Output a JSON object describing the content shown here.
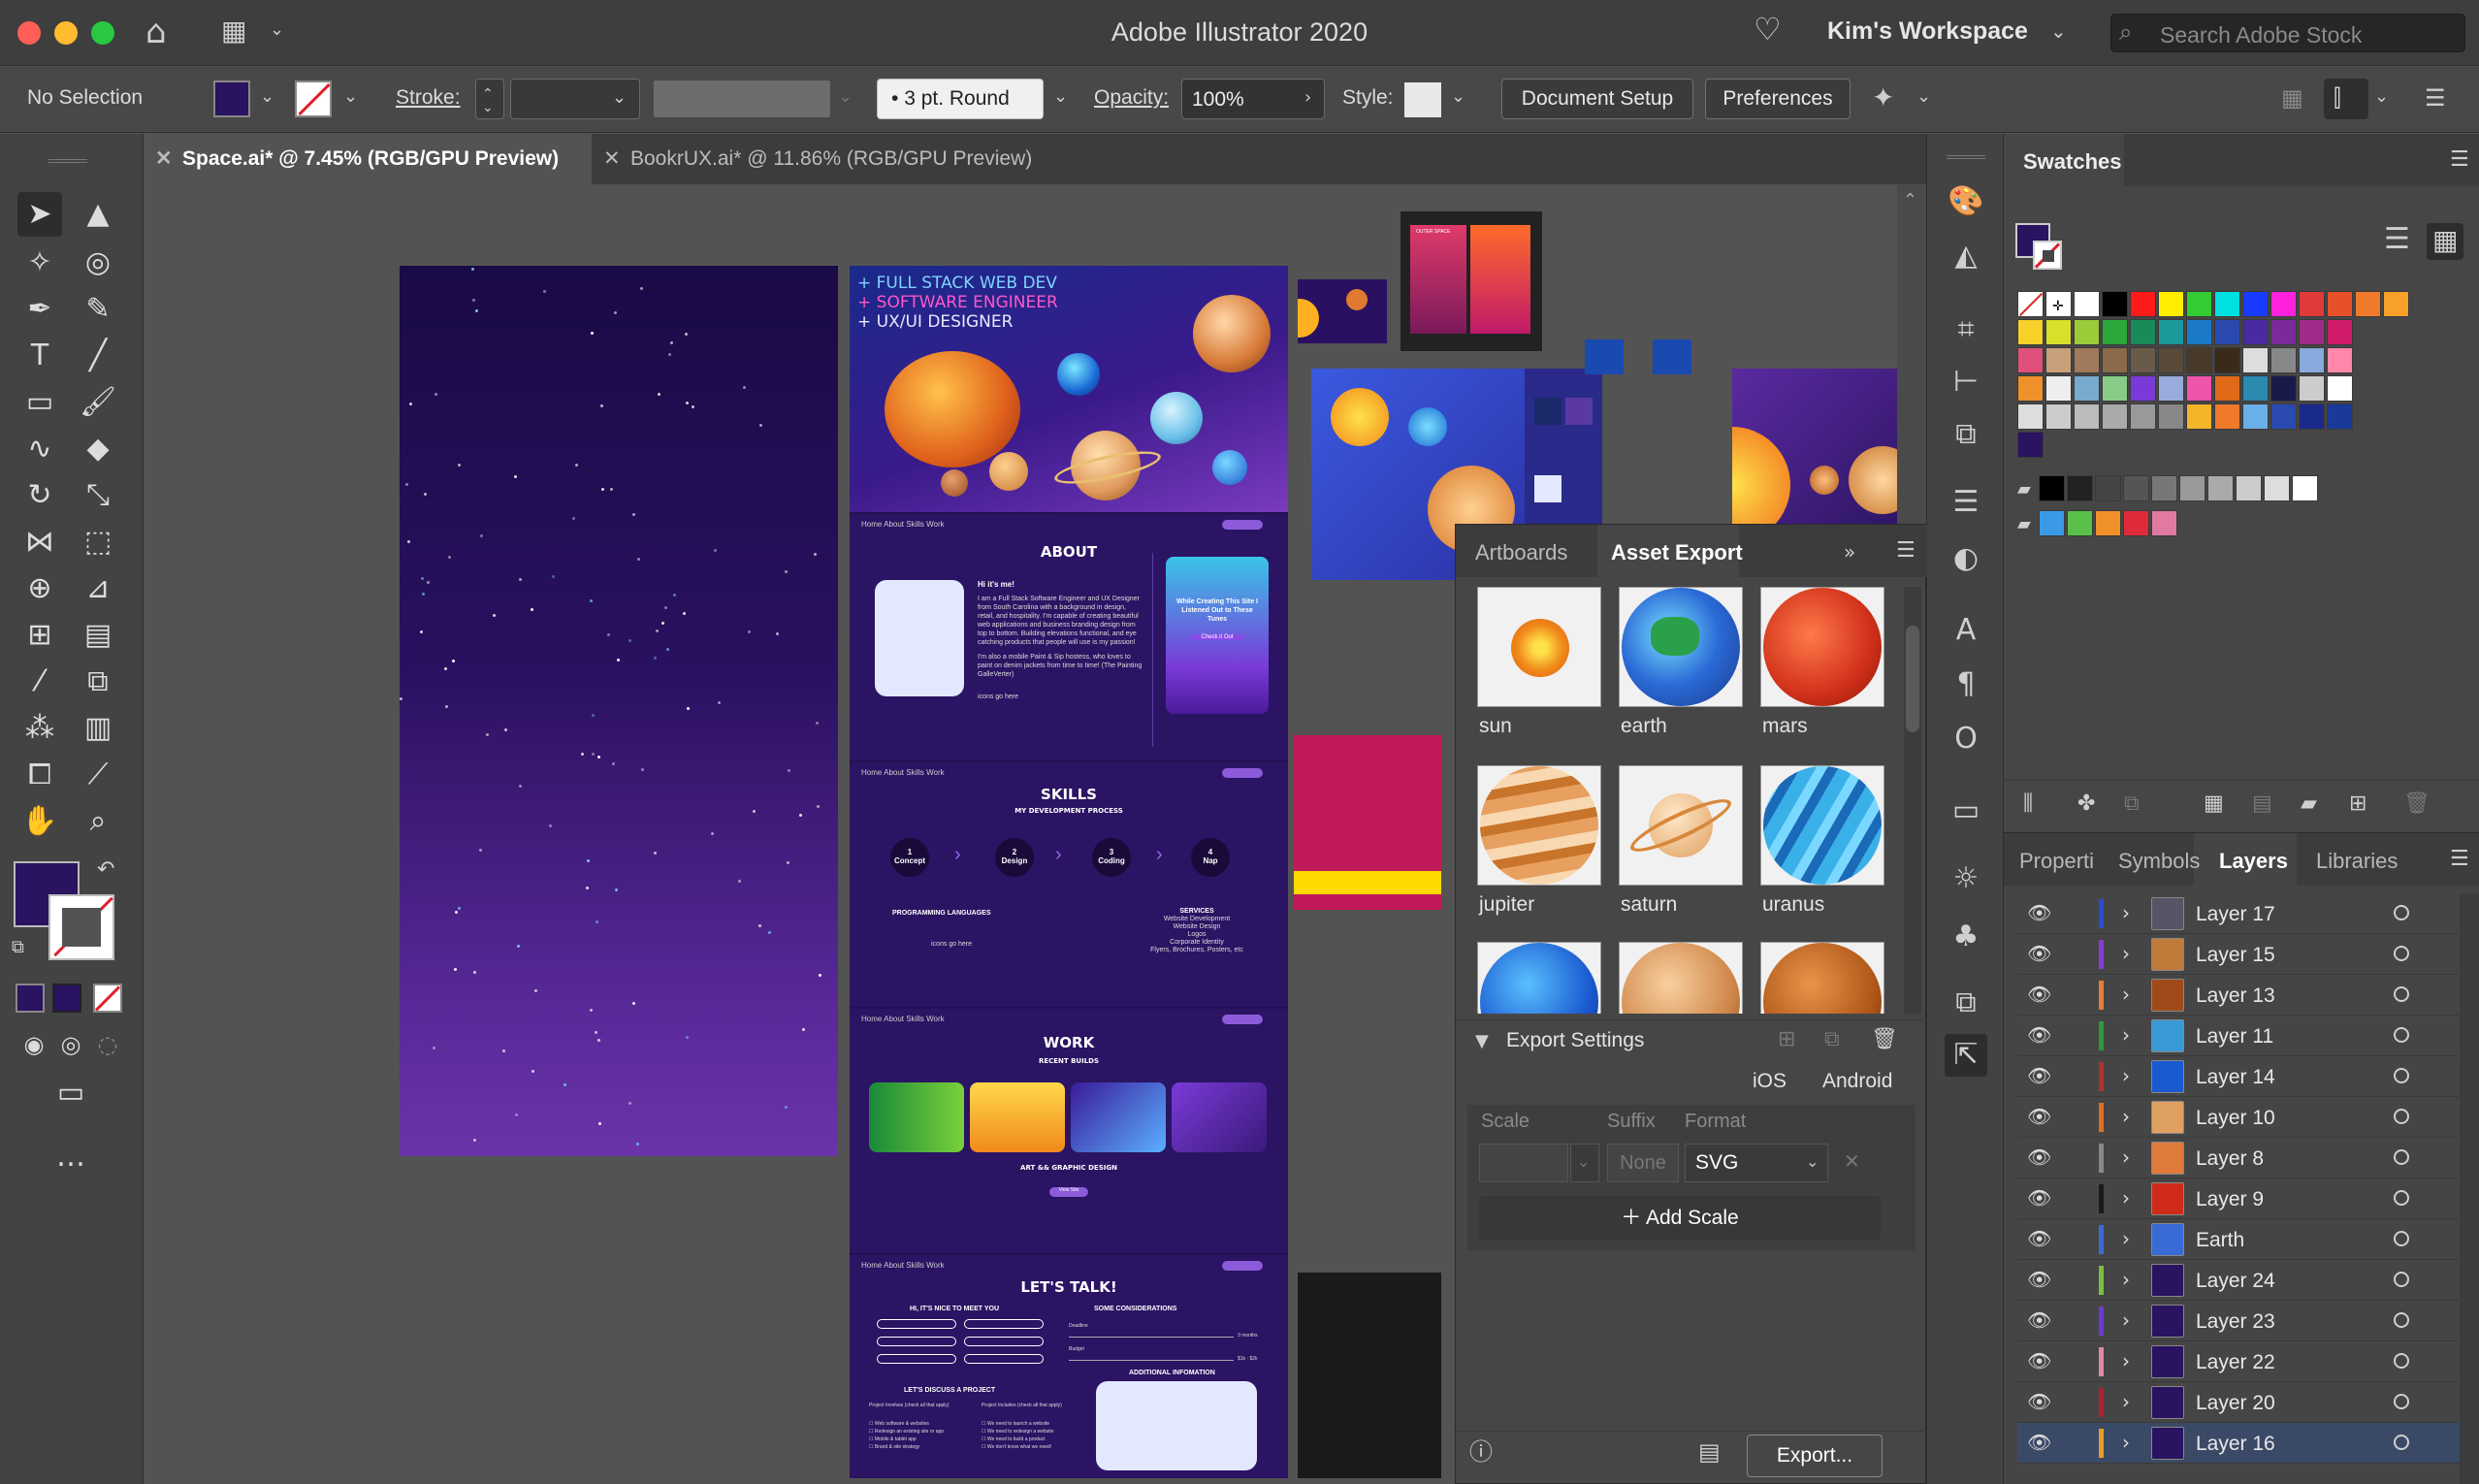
{
  "app": {
    "title": "Adobe Illustrator 2020",
    "workspace": "Kim's Workspace",
    "search_placeholder": "Search Adobe Stock"
  },
  "control_bar": {
    "selection": "No Selection",
    "stroke_label": "Stroke:",
    "brush": "3 pt. Round",
    "opacity_label": "Opacity:",
    "opacity_value": "100%",
    "style_label": "Style:",
    "document_setup": "Document Setup",
    "preferences": "Preferences",
    "fill_color": "#2a1360"
  },
  "tabs": [
    {
      "label": "Space.ai* @ 7.45% (RGB/GPU Preview)",
      "active": true
    },
    {
      "label": "BookrUX.ai* @ 11.86% (RGB/GPU Preview)",
      "active": false
    }
  ],
  "artboard": {
    "hero_lines": [
      "+ FULL STACK WEB DEV",
      "+ SOFTWARE ENGINEER",
      "+ UX/UI DESIGNER"
    ],
    "nav": "Home   About   Skills   Work",
    "pill": "Say Hi",
    "about_title": "ABOUT",
    "about_heading": "Hi it's me!",
    "about_body": "I am a Full Stack Software Engineer and UX Designer from South Carolina with a background in design, retail, and hospitality. I'm capable of creating beautiful web applications and business branding design from top to bottom. Building elevations functional, and eye catching products that people will use is my passion!",
    "about_body2": "I'm also a mobile Paint & Sip hostess, who loves to paint on denim jackets from time to time! (The Painting GalleVerter)",
    "about_icons": "icons go here",
    "about_card": "While Creating This Site I Listened Out to These Tunes",
    "about_card_btn": "Check it Out",
    "skills_title": "SKILLS",
    "skills_sub": "MY DEVELOPMENT PROCESS",
    "steps": [
      {
        "num": "1",
        "label": "Concept"
      },
      {
        "num": "2",
        "label": "Design"
      },
      {
        "num": "3",
        "label": "Coding"
      },
      {
        "num": "4",
        "label": "Nap"
      }
    ],
    "prog_lang": "PROGRAMMING LANGUAGES",
    "services": "SERVICES",
    "services_list": "Website Development\nWebsite Design\nLogos\nCorporate Identity\nFlyers, Brochures, Posters, etc",
    "icons_here": "icons go here",
    "work_title": "WORK",
    "work_sub": "RECENT BUILDS",
    "art_title": "ART && GRAPHIC DESIGN",
    "view_site": "View Site",
    "talk_title": "LET'S TALK!",
    "talk_sub": "HI, IT'S NICE TO MEET YOU",
    "considerations": "SOME CONSIDERATIONS",
    "deadline": "Deadline",
    "budget": "Budget",
    "months": "3 months",
    "budget_val": "$1k - $2k",
    "additional": "ADDITIONAL INFOMATION",
    "discuss": "LET'S DISCUSS A PROJECT",
    "project_involves": "Project Involves (check all that apply)",
    "project_includes": "Project Includes (check all that apply)",
    "checks_left": [
      "Web software & websites",
      "Redesign an existing site or app",
      "Mobile & tablet app",
      "Brand & site strategy"
    ],
    "checks_right": [
      "We need to launch a website",
      "We need to redesign a website",
      "We need to build a product",
      "We don't know what we need!"
    ],
    "poster_text": "OUTER SPACE"
  },
  "asset_export": {
    "tabs": [
      "Artboards",
      "Asset Export"
    ],
    "assets": [
      "sun",
      "earth",
      "mars",
      "jupiter",
      "saturn",
      "uranus"
    ],
    "export_settings": "Export Settings",
    "ios": "iOS",
    "android": "Android",
    "scale": "Scale",
    "suffix": "Suffix",
    "format": "Format",
    "suffix_value": "None",
    "format_value": "SVG",
    "add_scale": "Add Scale",
    "export": "Export..."
  },
  "swatches": {
    "title": "Swatches",
    "fill": "#2a1360"
  },
  "layers_panel": {
    "tabs": [
      "Properti",
      "Symbols",
      "Layers",
      "Libraries"
    ],
    "rows": [
      {
        "name": "Layer 17",
        "color": "#2a4dd6"
      },
      {
        "name": "Layer 15",
        "color": "#8a3bd6"
      },
      {
        "name": "Layer 13",
        "color": "#e0803a"
      },
      {
        "name": "Layer 11",
        "color": "#2d9a3a"
      },
      {
        "name": "Layer 14",
        "color": "#b03030"
      },
      {
        "name": "Layer 10",
        "color": "#e07020"
      },
      {
        "name": "Layer 8",
        "color": "#888888"
      },
      {
        "name": "Layer 9",
        "color": "#1a1a1a"
      },
      {
        "name": "Earth",
        "color": "#3a6ad6"
      },
      {
        "name": "Layer 24",
        "color": "#7ac040"
      },
      {
        "name": "Layer 23",
        "color": "#6a3ad6"
      },
      {
        "name": "Layer 22",
        "color": "#e08aa0"
      },
      {
        "name": "Layer 20",
        "color": "#b02030"
      },
      {
        "name": "Layer 16",
        "color": "#e0a020"
      }
    ]
  }
}
